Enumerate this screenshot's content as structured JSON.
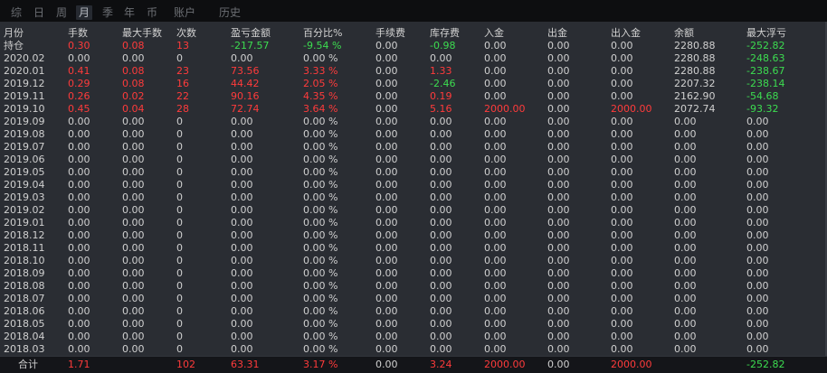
{
  "tabs": [
    {
      "label": "综",
      "active": false
    },
    {
      "label": "日",
      "active": false
    },
    {
      "label": "周",
      "active": false
    },
    {
      "label": "月",
      "active": true
    },
    {
      "label": "季",
      "active": false
    },
    {
      "label": "年",
      "active": false
    },
    {
      "label": "币",
      "active": false
    },
    {
      "label": "账户",
      "active": false
    },
    {
      "label": "历史",
      "active": false
    }
  ],
  "columns": [
    "月份",
    "手数",
    "最大手数",
    "次数",
    "盈亏金额",
    "百分比%",
    "手续费",
    "库存费",
    "入金",
    "出金",
    "出入金",
    "余额",
    "最大浮亏"
  ],
  "rows": [
    [
      "持仓",
      "0.30",
      "0.08",
      "13",
      "-217.57",
      "-9.54 %",
      "0.00",
      "-0.98",
      "0.00",
      "0.00",
      "0.00",
      "2280.88",
      "-252.82"
    ],
    [
      "2020.02",
      "0.00",
      "0.00",
      "0",
      "0.00",
      "0.00 %",
      "0.00",
      "0.00",
      "0.00",
      "0.00",
      "0.00",
      "2280.88",
      "-248.63"
    ],
    [
      "2020.01",
      "0.41",
      "0.08",
      "23",
      "73.56",
      "3.33 %",
      "0.00",
      "1.33",
      "0.00",
      "0.00",
      "0.00",
      "2280.88",
      "-238.67"
    ],
    [
      "2019.12",
      "0.29",
      "0.08",
      "16",
      "44.42",
      "2.05 %",
      "0.00",
      "-2.46",
      "0.00",
      "0.00",
      "0.00",
      "2207.32",
      "-238.14"
    ],
    [
      "2019.11",
      "0.26",
      "0.02",
      "22",
      "90.16",
      "4.35 %",
      "0.00",
      "0.19",
      "0.00",
      "0.00",
      "0.00",
      "2162.90",
      "-54.68"
    ],
    [
      "2019.10",
      "0.45",
      "0.04",
      "28",
      "72.74",
      "3.64 %",
      "0.00",
      "5.16",
      "2000.00",
      "0.00",
      "2000.00",
      "2072.74",
      "-93.32"
    ],
    [
      "2019.09",
      "0.00",
      "0.00",
      "0",
      "0.00",
      "0.00 %",
      "0.00",
      "0.00",
      "0.00",
      "0.00",
      "0.00",
      "0.00",
      "0.00"
    ],
    [
      "2019.08",
      "0.00",
      "0.00",
      "0",
      "0.00",
      "0.00 %",
      "0.00",
      "0.00",
      "0.00",
      "0.00",
      "0.00",
      "0.00",
      "0.00"
    ],
    [
      "2019.07",
      "0.00",
      "0.00",
      "0",
      "0.00",
      "0.00 %",
      "0.00",
      "0.00",
      "0.00",
      "0.00",
      "0.00",
      "0.00",
      "0.00"
    ],
    [
      "2019.06",
      "0.00",
      "0.00",
      "0",
      "0.00",
      "0.00 %",
      "0.00",
      "0.00",
      "0.00",
      "0.00",
      "0.00",
      "0.00",
      "0.00"
    ],
    [
      "2019.05",
      "0.00",
      "0.00",
      "0",
      "0.00",
      "0.00 %",
      "0.00",
      "0.00",
      "0.00",
      "0.00",
      "0.00",
      "0.00",
      "0.00"
    ],
    [
      "2019.04",
      "0.00",
      "0.00",
      "0",
      "0.00",
      "0.00 %",
      "0.00",
      "0.00",
      "0.00",
      "0.00",
      "0.00",
      "0.00",
      "0.00"
    ],
    [
      "2019.03",
      "0.00",
      "0.00",
      "0",
      "0.00",
      "0.00 %",
      "0.00",
      "0.00",
      "0.00",
      "0.00",
      "0.00",
      "0.00",
      "0.00"
    ],
    [
      "2019.02",
      "0.00",
      "0.00",
      "0",
      "0.00",
      "0.00 %",
      "0.00",
      "0.00",
      "0.00",
      "0.00",
      "0.00",
      "0.00",
      "0.00"
    ],
    [
      "2019.01",
      "0.00",
      "0.00",
      "0",
      "0.00",
      "0.00 %",
      "0.00",
      "0.00",
      "0.00",
      "0.00",
      "0.00",
      "0.00",
      "0.00"
    ],
    [
      "2018.12",
      "0.00",
      "0.00",
      "0",
      "0.00",
      "0.00 %",
      "0.00",
      "0.00",
      "0.00",
      "0.00",
      "0.00",
      "0.00",
      "0.00"
    ],
    [
      "2018.11",
      "0.00",
      "0.00",
      "0",
      "0.00",
      "0.00 %",
      "0.00",
      "0.00",
      "0.00",
      "0.00",
      "0.00",
      "0.00",
      "0.00"
    ],
    [
      "2018.10",
      "0.00",
      "0.00",
      "0",
      "0.00",
      "0.00 %",
      "0.00",
      "0.00",
      "0.00",
      "0.00",
      "0.00",
      "0.00",
      "0.00"
    ],
    [
      "2018.09",
      "0.00",
      "0.00",
      "0",
      "0.00",
      "0.00 %",
      "0.00",
      "0.00",
      "0.00",
      "0.00",
      "0.00",
      "0.00",
      "0.00"
    ],
    [
      "2018.08",
      "0.00",
      "0.00",
      "0",
      "0.00",
      "0.00 %",
      "0.00",
      "0.00",
      "0.00",
      "0.00",
      "0.00",
      "0.00",
      "0.00"
    ],
    [
      "2018.07",
      "0.00",
      "0.00",
      "0",
      "0.00",
      "0.00 %",
      "0.00",
      "0.00",
      "0.00",
      "0.00",
      "0.00",
      "0.00",
      "0.00"
    ],
    [
      "2018.06",
      "0.00",
      "0.00",
      "0",
      "0.00",
      "0.00 %",
      "0.00",
      "0.00",
      "0.00",
      "0.00",
      "0.00",
      "0.00",
      "0.00"
    ],
    [
      "2018.05",
      "0.00",
      "0.00",
      "0",
      "0.00",
      "0.00 %",
      "0.00",
      "0.00",
      "0.00",
      "0.00",
      "0.00",
      "0.00",
      "0.00"
    ],
    [
      "2018.04",
      "0.00",
      "0.00",
      "0",
      "0.00",
      "0.00 %",
      "0.00",
      "0.00",
      "0.00",
      "0.00",
      "0.00",
      "0.00",
      "0.00"
    ],
    [
      "2018.03",
      "0.00",
      "0.00",
      "0",
      "0.00",
      "0.00 %",
      "0.00",
      "0.00",
      "0.00",
      "0.00",
      "0.00",
      "0.00",
      "0.00"
    ]
  ],
  "totals": [
    "合计",
    "1.71",
    "",
    "102",
    "63.31",
    "3.17 %",
    "0.00",
    "3.24",
    "2000.00",
    "0.00",
    "2000.00",
    "",
    "-252.82"
  ],
  "colors": {
    "positive": "#ff3b3b",
    "negative": "#3cdc50",
    "neutral": "#d0d0d0",
    "header": "#d2d2d2"
  }
}
